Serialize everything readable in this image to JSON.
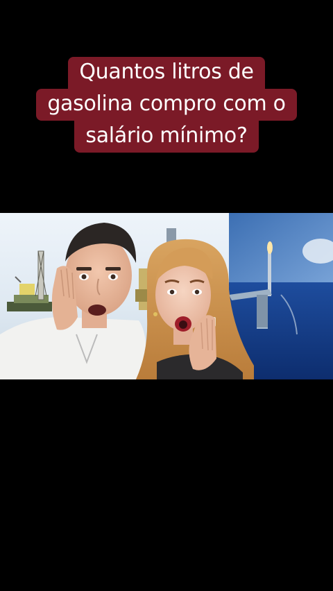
{
  "caption": {
    "line1": "Quantos litros de",
    "line2": "gasolina compro com o",
    "line3": "salário mínimo?"
  },
  "colors": {
    "background": "#000000",
    "caption_bg": "#7b1a27",
    "caption_text": "#ffffff"
  },
  "scene": {
    "description_icons": [
      "oil-rig-icon",
      "offshore-platform-icon"
    ]
  }
}
